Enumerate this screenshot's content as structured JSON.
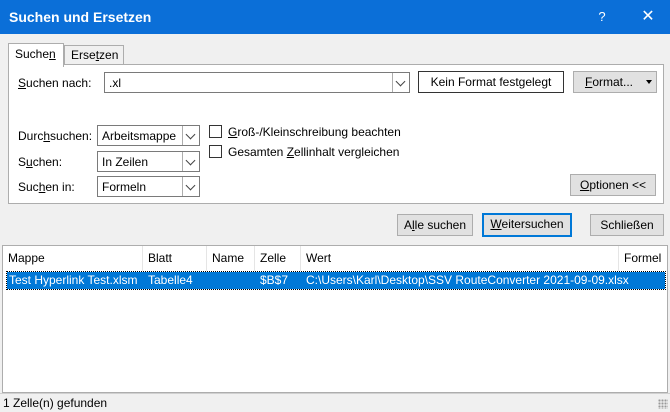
{
  "window": {
    "title": "Suchen und Ersetzen",
    "help_label": "?",
    "close_label": "✕"
  },
  "tabs": [
    {
      "label_pre": "Suche",
      "label_u": "n",
      "label_post": "",
      "active": true
    },
    {
      "label_pre": "Erse",
      "label_u": "t",
      "label_post": "zen",
      "active": false
    }
  ],
  "search": {
    "label_pre": "",
    "label_u": "S",
    "label_post": "uchen nach:",
    "value": ".xl",
    "format_status": "Kein Format festgelegt",
    "format_button_pre": "",
    "format_button_u": "F",
    "format_button_post": "ormat..."
  },
  "options": {
    "within": {
      "label_pre": "Durc",
      "label_u": "h",
      "label_post": "suchen:",
      "value": "Arbeitsmappe"
    },
    "search": {
      "label_pre": "S",
      "label_u": "u",
      "label_post": "chen:",
      "value": "In Zeilen"
    },
    "look_in": {
      "label_pre": "Suc",
      "label_u": "h",
      "label_post": "en in:",
      "value": "Formeln"
    },
    "match_case": {
      "label_pre": "",
      "label_u": "G",
      "label_post": "roß-/Kleinschreibung beachten",
      "checked": false
    },
    "entire_cell": {
      "label_pre": "Gesamten ",
      "label_u": "Z",
      "label_post": "ellinhalt vergleichen",
      "checked": false
    },
    "options_button_pre": "",
    "options_button_u": "O",
    "options_button_post": "ptionen <<"
  },
  "actions": {
    "find_all_pre": "A",
    "find_all_u": "l",
    "find_all_post": "le suchen",
    "find_next_pre": "",
    "find_next_u": "W",
    "find_next_post": "eitersuchen",
    "close": "Schließen"
  },
  "results": {
    "columns": [
      "Mappe",
      "Blatt",
      "Name",
      "Zelle",
      "Wert",
      "Formel"
    ],
    "rows": [
      {
        "mappe": "Test Hyperlink Test.xlsm",
        "blatt": "Tabelle4",
        "name": "",
        "zelle": "$B$7",
        "wert": "C:\\Users\\Karl\\Desktop\\SSV RouteConverter 2021-09-09.xlsx",
        "formel": ""
      }
    ]
  },
  "status": "1 Zelle(n) gefunden"
}
